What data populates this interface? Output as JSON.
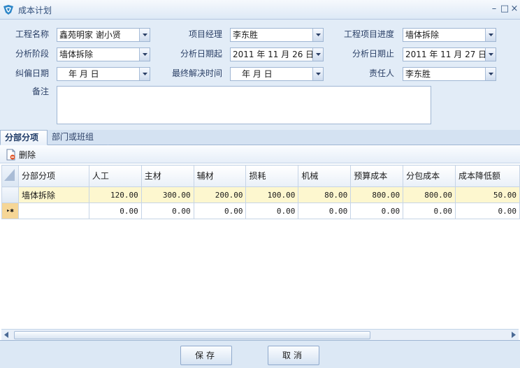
{
  "window": {
    "title": "成本计划",
    "min_label": "–",
    "restore_label": "□",
    "close_label": "×"
  },
  "form": {
    "labels": {
      "project_name": "工程名称",
      "project_manager": "项目经理",
      "project_progress": "工程项目进度",
      "analysis_stage": "分析阶段",
      "analysis_start": "分析日期起",
      "analysis_end": "分析日期止",
      "correction_date": "纠偏日期",
      "final_resolution": "最终解决时间",
      "responsible": "责任人",
      "remarks": "备注"
    },
    "values": {
      "project_name": "鑫苑明家 谢小贤",
      "project_manager": "李东胜",
      "project_progress": "墙体拆除",
      "analysis_stage": "墙体拆除",
      "analysis_start": "2011 年 11 月 26 日",
      "analysis_end": "2011 年 11 月 27 日",
      "correction_date": "年   月   日",
      "final_resolution": "年   月   日",
      "responsible": "李东胜",
      "remarks": ""
    }
  },
  "tabs": [
    {
      "label": "分部分项"
    },
    {
      "label": "部门或班组"
    }
  ],
  "toolbar": {
    "delete_label": "删除"
  },
  "grid": {
    "columns": [
      "分部分项",
      "人工",
      "主材",
      "辅材",
      "损耗",
      "机械",
      "预算成本",
      "分包成本",
      "成本降低额"
    ],
    "rows": [
      {
        "name": "墙体拆除",
        "values": [
          "120.00",
          "300.00",
          "200.00",
          "100.00",
          "80.00",
          "800.00",
          "800.00",
          "50.00"
        ]
      },
      {
        "name": "",
        "indicator": "▸✱",
        "values": [
          "0.00",
          "0.00",
          "0.00",
          "0.00",
          "0.00",
          "0.00",
          "0.00",
          "0.00"
        ]
      }
    ]
  },
  "footer": {
    "save_label": "保存",
    "cancel_label": "取消"
  },
  "colors": {
    "accent": "#2f4d7a",
    "background": "#dce8f5",
    "selected_row": "#fdf7cf"
  }
}
